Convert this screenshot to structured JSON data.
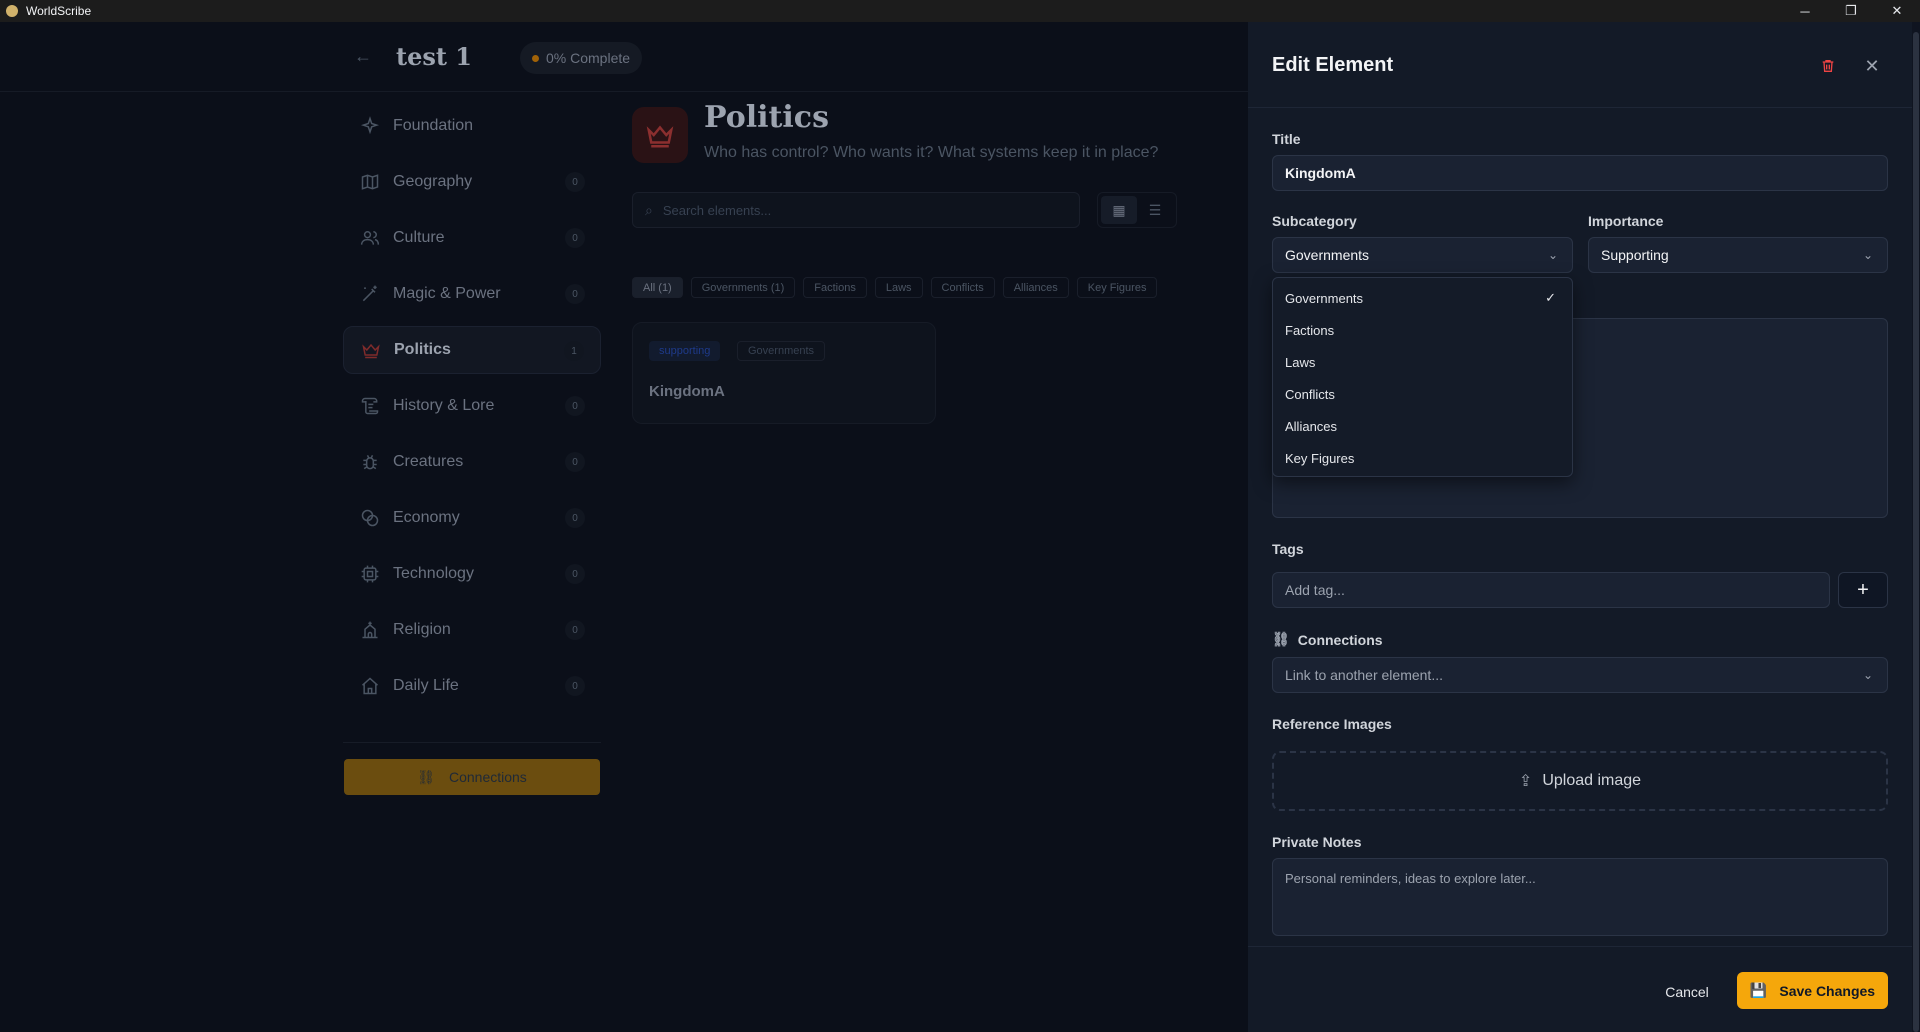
{
  "window": {
    "title": "WorldScribe",
    "controls": [
      "─",
      "❐",
      "✕"
    ]
  },
  "header": {
    "back_icon": "arrow-left-icon",
    "project_title": "test 1",
    "progress_label": "0% Complete"
  },
  "sidebar": {
    "items": [
      {
        "label": "Foundation",
        "count": "",
        "icon": "sparkles-icon"
      },
      {
        "label": "Geography",
        "count": "0",
        "icon": "map-icon"
      },
      {
        "label": "Culture",
        "count": "0",
        "icon": "users-icon"
      },
      {
        "label": "Magic & Power",
        "count": "0",
        "icon": "wand-icon"
      },
      {
        "label": "Politics",
        "count": "1",
        "icon": "crown-icon",
        "active": true
      },
      {
        "label": "History & Lore",
        "count": "0",
        "icon": "scroll-icon"
      },
      {
        "label": "Creatures",
        "count": "0",
        "icon": "bug-icon"
      },
      {
        "label": "Economy",
        "count": "0",
        "icon": "coins-icon"
      },
      {
        "label": "Technology",
        "count": "0",
        "icon": "cpu-icon"
      },
      {
        "label": "Religion",
        "count": "0",
        "icon": "church-icon"
      },
      {
        "label": "Daily Life",
        "count": "0",
        "icon": "home-icon"
      }
    ],
    "connections_label": "Connections"
  },
  "content": {
    "title": "Politics",
    "subtitle": "Who has control? Who wants it? What systems keep it in place?",
    "search_placeholder": "Search elements...",
    "filters": [
      "All (1)",
      "Governments (1)",
      "Factions",
      "Laws",
      "Conflicts",
      "Alliances",
      "Key Figures"
    ],
    "card": {
      "badge_importance": "supporting",
      "badge_subcategory": "Governments",
      "title": "KingdomA"
    }
  },
  "drawer": {
    "title": "Edit Element",
    "title_label": "Title",
    "title_value": "KingdomA",
    "subcategory_label": "Subcategory",
    "subcategory_value": "Governments",
    "importance_label": "Importance",
    "importance_value": "Supporting",
    "tags_label": "Tags",
    "tags_placeholder": "Add tag...",
    "add_tag_symbol": "+",
    "connections_label": "Connections",
    "connections_placeholder": "Link to another element...",
    "reference_images_label": "Reference Images",
    "upload_label": "Upload image",
    "private_notes_label": "Private Notes",
    "private_notes_placeholder": "Personal reminders, ideas to explore later...",
    "cancel_label": "Cancel",
    "save_label": "Save Changes",
    "dropdown_options": [
      {
        "label": "Governments",
        "selected": true
      },
      {
        "label": "Factions"
      },
      {
        "label": "Laws"
      },
      {
        "label": "Conflicts"
      },
      {
        "label": "Alliances"
      },
      {
        "label": "Key Figures"
      }
    ]
  },
  "colors": {
    "accent": "#f5a70b",
    "danger": "#ef4444",
    "drawer_bg": "#131a27",
    "app_bg": "#0b0f19"
  }
}
